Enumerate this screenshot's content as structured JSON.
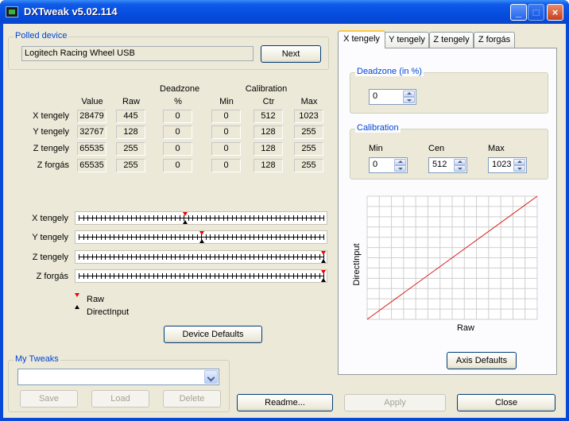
{
  "window": {
    "title": "DXTweak v5.02.114"
  },
  "polled_device": {
    "group_label": "Polled device",
    "device_name": "Logitech Racing Wheel USB",
    "next_label": "Next"
  },
  "table": {
    "group_headers": {
      "deadzone": "Deadzone",
      "calibration": "Calibration"
    },
    "columns": [
      "Value",
      "Raw",
      "%",
      "Min",
      "Ctr",
      "Max"
    ],
    "rows": [
      {
        "label": "X tengely",
        "values": [
          "28479",
          "445",
          "0",
          "0",
          "512",
          "1023"
        ]
      },
      {
        "label": "Y tengely",
        "values": [
          "32767",
          "128",
          "0",
          "0",
          "128",
          "255"
        ]
      },
      {
        "label": "Z tengely",
        "values": [
          "65535",
          "255",
          "0",
          "0",
          "128",
          "255"
        ]
      },
      {
        "label": "Z forgás",
        "values": [
          "65535",
          "255",
          "0",
          "0",
          "128",
          "255"
        ]
      }
    ]
  },
  "sliders": [
    {
      "label": "X tengely",
      "raw": 0.435,
      "directinput": 0.435
    },
    {
      "label": "Y tengely",
      "raw": 0.502,
      "directinput": 0.502
    },
    {
      "label": "Z tengely",
      "raw": 1.0,
      "directinput": 1.0
    },
    {
      "label": "Z forgás",
      "raw": 1.0,
      "directinput": 1.0
    }
  ],
  "legend": {
    "raw": "Raw",
    "directinput": "DirectInput"
  },
  "device_defaults_label": "Device Defaults",
  "my_tweaks": {
    "group_label": "My Tweaks",
    "selected": "",
    "save_label": "Save",
    "load_label": "Load",
    "delete_label": "Delete"
  },
  "tabs": [
    "X tengely",
    "Y tengely",
    "Z tengely",
    "Z forgás"
  ],
  "axis_panel": {
    "deadzone_label": "Deadzone (in %)",
    "deadzone_value": "0",
    "calibration_label": "Calibration",
    "min_label": "Min",
    "cen_label": "Cen",
    "max_label": "Max",
    "min_value": "0",
    "cen_value": "512",
    "max_value": "1023",
    "axis_defaults_label": "Axis Defaults"
  },
  "chart_data": {
    "type": "line",
    "xlabel": "Raw",
    "ylabel": "DirectInput",
    "x": [
      0,
      1023
    ],
    "y": [
      0,
      1023
    ],
    "grid": true,
    "line_color": "#d81a1a"
  },
  "footer": {
    "readme_label": "Readme...",
    "apply_label": "Apply",
    "close_label": "Close"
  },
  "colors": {
    "titlebar": "#0750e2",
    "group_label": "#0046d5",
    "raw_marker": "#e00000",
    "di_marker": "#000000",
    "active_tab": "#ffc83c"
  }
}
